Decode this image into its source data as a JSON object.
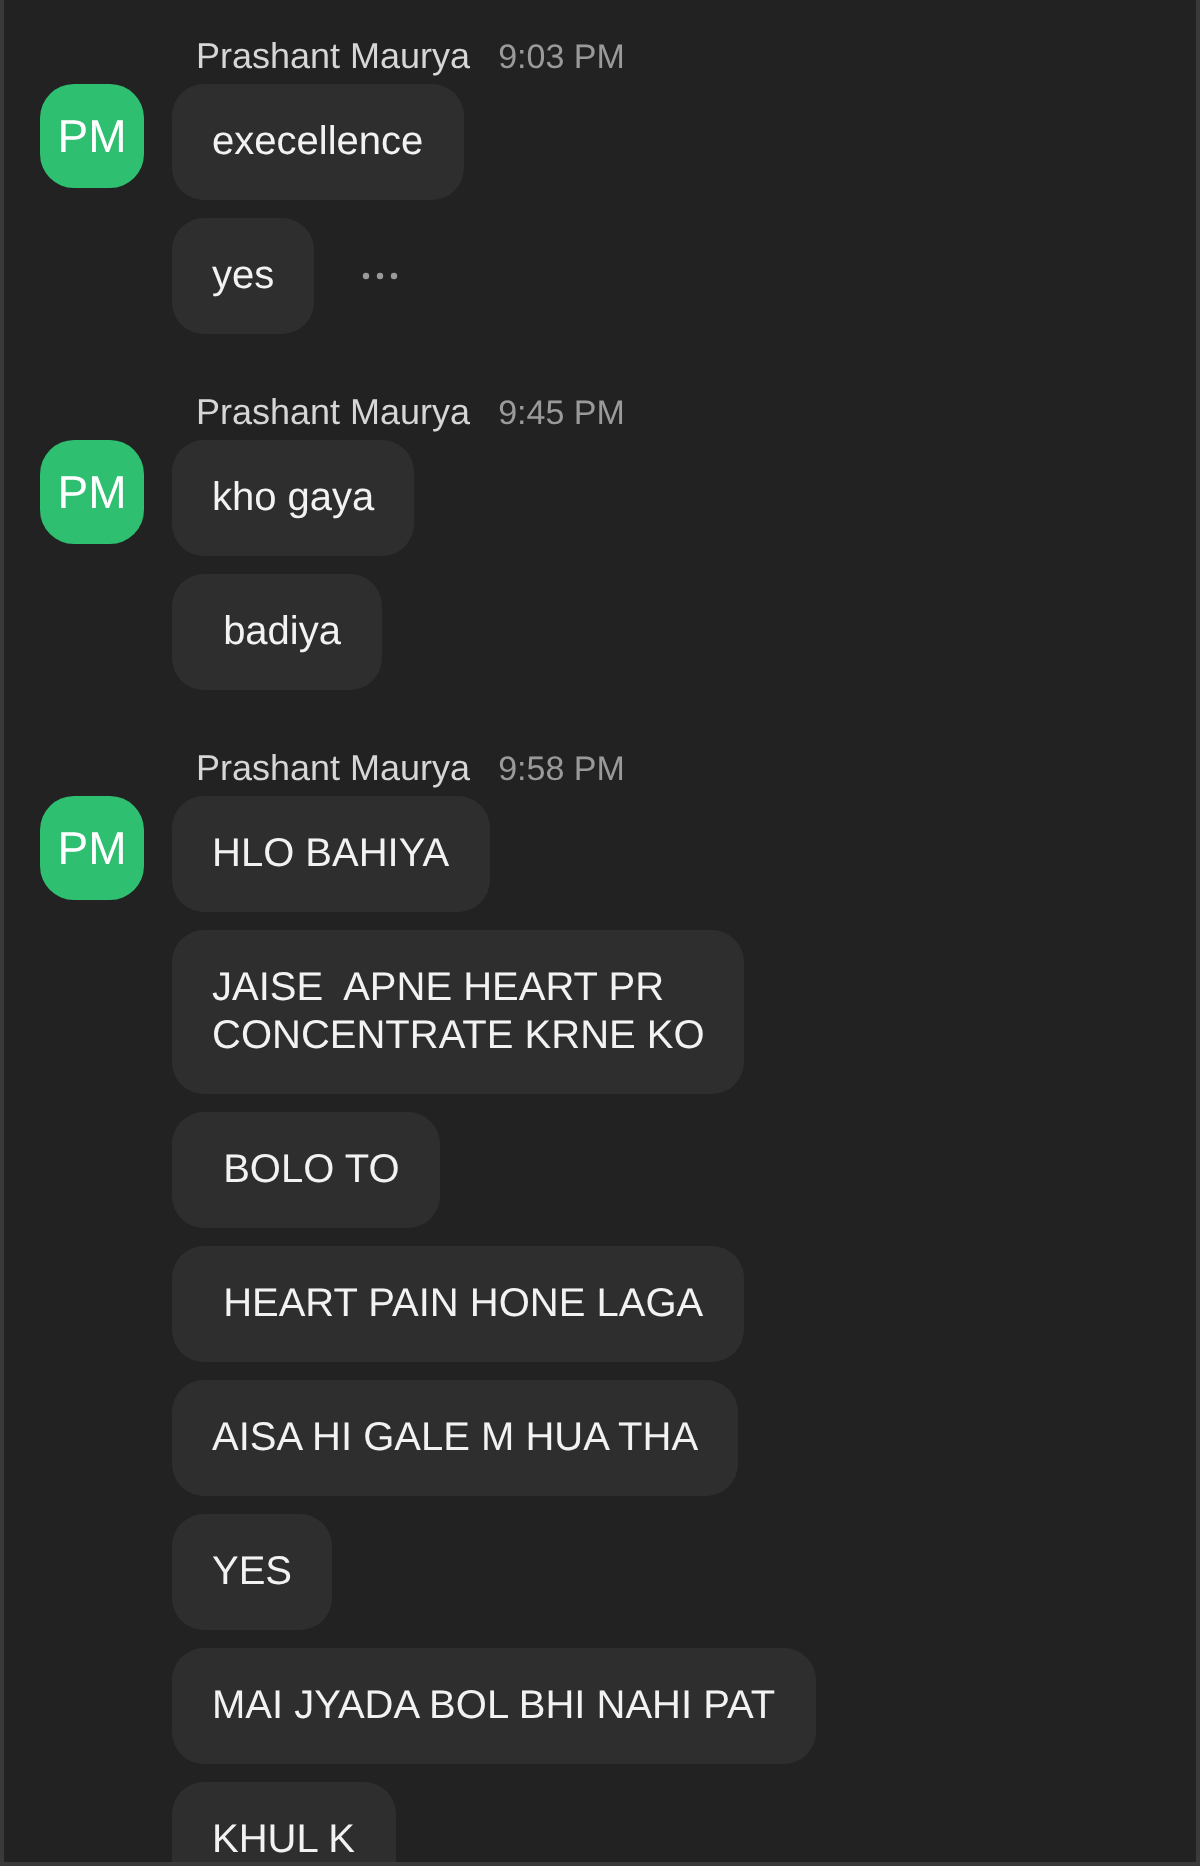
{
  "groups": [
    {
      "avatar": "PM",
      "sender": "Prashant Maurya",
      "time": "9:03 PM",
      "messages": [
        {
          "text": "execellence",
          "hovered": false
        },
        {
          "text": "yes",
          "hovered": true
        }
      ]
    },
    {
      "avatar": "PM",
      "sender": "Prashant Maurya",
      "time": "9:45 PM",
      "messages": [
        {
          "text": "kho gaya",
          "hovered": false
        },
        {
          "text": " badiya",
          "hovered": false
        }
      ]
    },
    {
      "avatar": "PM",
      "sender": "Prashant Maurya",
      "time": "9:58 PM",
      "messages": [
        {
          "text": "HLO BAHIYA",
          "hovered": false
        },
        {
          "text": "JAISE  APNE HEART PR\nCONCENTRATE KRNE KO",
          "hovered": false
        },
        {
          "text": " BOLO TO",
          "hovered": false
        },
        {
          "text": " HEART PAIN HONE LAGA",
          "hovered": false
        },
        {
          "text": "AISA HI GALE M HUA THA",
          "hovered": false
        },
        {
          "text": "YES",
          "hovered": false
        },
        {
          "text": "MAI JYADA BOL BHI NAHI PAT",
          "hovered": false
        },
        {
          "text": "KHUL K",
          "hovered": false
        }
      ]
    }
  ]
}
